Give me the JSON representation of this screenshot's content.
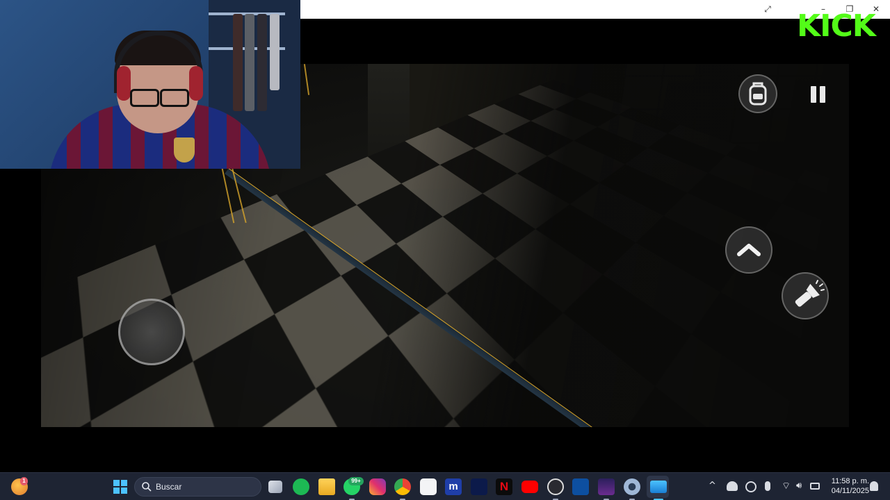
{
  "window": {
    "expand_icon": "expand-icon",
    "minimize": "–",
    "maximize": "❐",
    "close": "✕"
  },
  "brand": {
    "logo_text": "KICK",
    "color": "#53fc18"
  },
  "game": {
    "controls": [
      "joystick",
      "backpack-icon",
      "pause-icon",
      "jump-arrow-icon",
      "flashlight-icon"
    ]
  },
  "taskbar": {
    "search_placeholder": "Buscar",
    "weather_badge": "1",
    "whatsapp_badge": "99+",
    "apps": [
      "windows-start",
      "search",
      "task-view",
      "spotify",
      "file-explorer",
      "whatsapp",
      "instagram",
      "chrome",
      "microsoft-store",
      "mercado",
      "disney-plus",
      "netflix",
      "youtube",
      "obs",
      "festo",
      "game-app",
      "settings",
      "connect"
    ],
    "tray": {
      "chevron": "^",
      "clock_time": "11:58 p. m.",
      "clock_date": "04/11/2025"
    }
  },
  "colors": {
    "taskbar_bg": "#1e2433",
    "accent": "#53fc18",
    "outline": "#d6a42a"
  }
}
